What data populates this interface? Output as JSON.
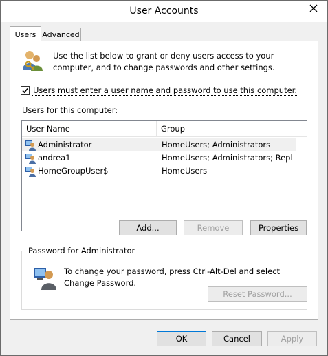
{
  "window": {
    "title": "User Accounts"
  },
  "tabs": [
    {
      "label": "Users",
      "active": true
    },
    {
      "label": "Advanced",
      "active": false
    }
  ],
  "intro": {
    "text": "Use the list below to grant or deny users access to your computer, and to change passwords and other settings."
  },
  "require_login": {
    "checked": true,
    "label": "Users must enter a user name and password to use this computer."
  },
  "users_list": {
    "label": "Users for this computer:",
    "columns": [
      "User Name",
      "Group"
    ],
    "rows": [
      {
        "name": "Administrator",
        "group": "HomeUsers; Administrators",
        "selected": true
      },
      {
        "name": "andrea1",
        "group": "HomeUsers; Administrators; Repli...",
        "selected": false
      },
      {
        "name": "HomeGroupUser$",
        "group": "HomeUsers",
        "selected": false
      }
    ]
  },
  "list_buttons": {
    "add": "Add...",
    "remove": "Remove",
    "properties": "Properties"
  },
  "password_group": {
    "legend": "Password for Administrator",
    "text": "To change your password, press Ctrl-Alt-Del and select Change Password.",
    "reset_button": "Reset Password..."
  },
  "footer_buttons": {
    "ok": "OK",
    "cancel": "Cancel",
    "apply": "Apply"
  },
  "colors": {
    "selected_row": "#f0f0f0",
    "focus_border": "#0078d7",
    "disabled_text": "#a0a0a0"
  },
  "icons": [
    "close-icon",
    "users-keys-icon",
    "user-icon",
    "user-computer-icon",
    "checkmark-icon"
  ]
}
